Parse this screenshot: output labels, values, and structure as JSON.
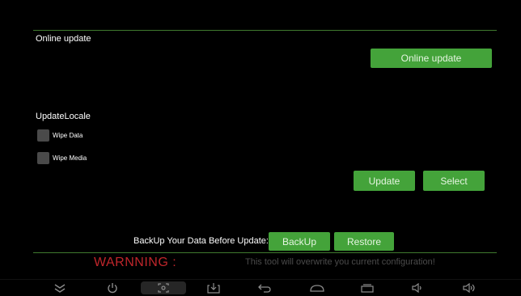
{
  "online_section": {
    "title": "Online update",
    "button_label": "Online update"
  },
  "local_section": {
    "title": "UpdateLocale",
    "options": [
      {
        "label": "Wipe Data",
        "checked": false
      },
      {
        "label": "Wipe Media",
        "checked": false
      }
    ],
    "update_label": "Update",
    "select_label": "Select"
  },
  "backup_section": {
    "prompt": "BackUp Your Data Before Update:",
    "backup_label": "BackUp",
    "restore_label": "Restore"
  },
  "warning": {
    "title": "WARNNING :",
    "message": "This tool will overwrite you current configuration!"
  },
  "navbar_icons": [
    "collapse-icon",
    "power-icon",
    "screenshot-icon",
    "download-icon",
    "back-icon",
    "home-icon",
    "recents-icon",
    "volume-down-icon",
    "volume-up-icon"
  ],
  "colors": {
    "accent": "#44a33a",
    "divider": "#3f7a2e",
    "warning": "#c0262b",
    "muted_text": "#4b4b4b"
  }
}
